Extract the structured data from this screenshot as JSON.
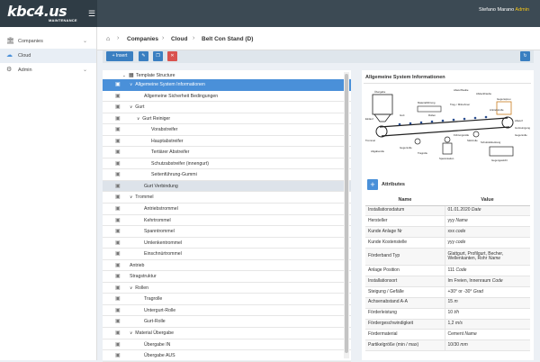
{
  "app": {
    "logo_main": "kbc4.us",
    "logo_sub": "MAINTENANCE",
    "user_name": "Stefano Marano",
    "user_role": "Admin"
  },
  "sidebar": {
    "items": [
      {
        "label": "Companies",
        "icon": "building-icon",
        "has_chevron": true
      },
      {
        "label": "Cloud",
        "icon": "cloud-icon",
        "has_chevron": false
      },
      {
        "label": "Admin",
        "icon": "settings-icon",
        "has_chevron": true
      }
    ]
  },
  "breadcrumb": {
    "items": [
      "Companies",
      "Cloud",
      "Belt Con Stand (D)"
    ]
  },
  "toolbar": {
    "insert_label": "Insert"
  },
  "tree": {
    "root": "Template Structure",
    "rows": [
      {
        "label": "Allgemeine System Informationen",
        "chev": "v",
        "state": "sel"
      },
      {
        "label": "Allgemeine Sicherheit Bedingungen",
        "chev": "",
        "state": ""
      },
      {
        "label": "Gurt",
        "chev": "v",
        "state": ""
      },
      {
        "label": "Gurt Reiniger",
        "chev": "v",
        "state": ""
      },
      {
        "label": "Vorabstreifer",
        "chev": "",
        "state": ""
      },
      {
        "label": "Hauptabstreifer",
        "chev": "",
        "state": ""
      },
      {
        "label": "Tertiärer Abstreifer",
        "chev": "",
        "state": ""
      },
      {
        "label": "Schutzabstreifer (innengurt)",
        "chev": "",
        "state": ""
      },
      {
        "label": "Seitenführung-Gummi",
        "chev": "",
        "state": ""
      },
      {
        "label": "Gurt Verbindung",
        "chev": "",
        "state": "hl"
      },
      {
        "label": "Trommel",
        "chev": "v",
        "state": ""
      },
      {
        "label": "Antriebstrommel",
        "chev": "",
        "state": ""
      },
      {
        "label": "Kehrtrommel",
        "chev": "",
        "state": ""
      },
      {
        "label": "Spanntrommel",
        "chev": "",
        "state": ""
      },
      {
        "label": "Umlenkentrommel",
        "chev": "",
        "state": ""
      },
      {
        "label": "Einschnürtrommel",
        "chev": "",
        "state": ""
      },
      {
        "label": "Antrieb",
        "chev": "",
        "state": ""
      },
      {
        "label": "Stragstruktur",
        "chev": "",
        "state": ""
      },
      {
        "label": "Rollen",
        "chev": "v",
        "state": ""
      },
      {
        "label": "Tragrolle",
        "chev": "",
        "state": ""
      },
      {
        "label": "Untergurt-Rolle",
        "chev": "",
        "state": ""
      },
      {
        "label": "Gurt-Rolle",
        "chev": "",
        "state": ""
      },
      {
        "label": "Material Übergabe",
        "chev": "v",
        "state": ""
      },
      {
        "label": "Übergabe IN",
        "chev": "",
        "state": ""
      },
      {
        "label": "Übergabe AUS",
        "chev": "",
        "state": ""
      }
    ]
  },
  "info": {
    "title": "Allgemeine System Informationen"
  },
  "diagram": {
    "labels": [
      "Übergabe",
      "Abwurfhaube",
      "Abdeckhaube",
      "Gegenspreu",
      "Materialführung",
      "Trag- / Mitnehmer",
      "Gurt",
      "Rollen",
      "Gurtreinigung",
      "Gegenrolle",
      "Einlauf",
      "Trommel",
      "Gegenrolle",
      "Antriebsrolle",
      "Abwurf",
      "Führungsrolle",
      "Stützrolle",
      "Spannstation",
      "Abgaberolle",
      "Tragrolle",
      "Schutzabdeckung",
      "Gegengewicht"
    ]
  },
  "attributes": {
    "title": "Attributes",
    "col_name": "Name",
    "col_value": "Value",
    "rows": [
      {
        "name": "Installationsdatum",
        "value": "01.01.2020",
        "hint": "Date",
        "tall": false
      },
      {
        "name": "Hersteller",
        "value": "yyy",
        "hint": "Name",
        "tall": false
      },
      {
        "name": "Kunde Anlage Nr",
        "value": "xxx",
        "hint": "code",
        "tall": false
      },
      {
        "name": "Kunde Kostenstelle",
        "value": "yyy",
        "hint": "code",
        "tall": false
      },
      {
        "name": "Förderband Typ",
        "value": "Glattgurt, Profilgurt, Becher, Wellenkanten, Rohr",
        "hint": "Name",
        "tall": true
      },
      {
        "name": "Anlage Position",
        "value": "111",
        "hint": "Code",
        "tall": false
      },
      {
        "name": "Installationsort",
        "value": "Im Freien, Innenraum",
        "hint": "Code",
        "tall": false
      },
      {
        "name": "Steigung / Gefälle",
        "value": "+30° or -30°",
        "hint": "Grad",
        "tall": false
      },
      {
        "name": "Achsenabstand A-A",
        "value": "15",
        "hint": "m",
        "tall": false
      },
      {
        "name": "Förderleistung",
        "value": "10",
        "hint": "t/h",
        "tall": false
      },
      {
        "name": "Fördergeschwindigkeit",
        "value": "1,2",
        "hint": "m/s",
        "tall": false
      },
      {
        "name": "Fördermaterial",
        "value": "Cement",
        "hint": "Name",
        "tall": false
      },
      {
        "name": "Partikelgröße (min / max)",
        "value": "10/30",
        "hint": "mm",
        "tall": false
      }
    ]
  },
  "colors": {
    "topbar": "#3c4a54",
    "accent": "#4a90d9",
    "toolbar_insert": "#3a7fc1",
    "toolbar_delete": "#d9534f"
  }
}
